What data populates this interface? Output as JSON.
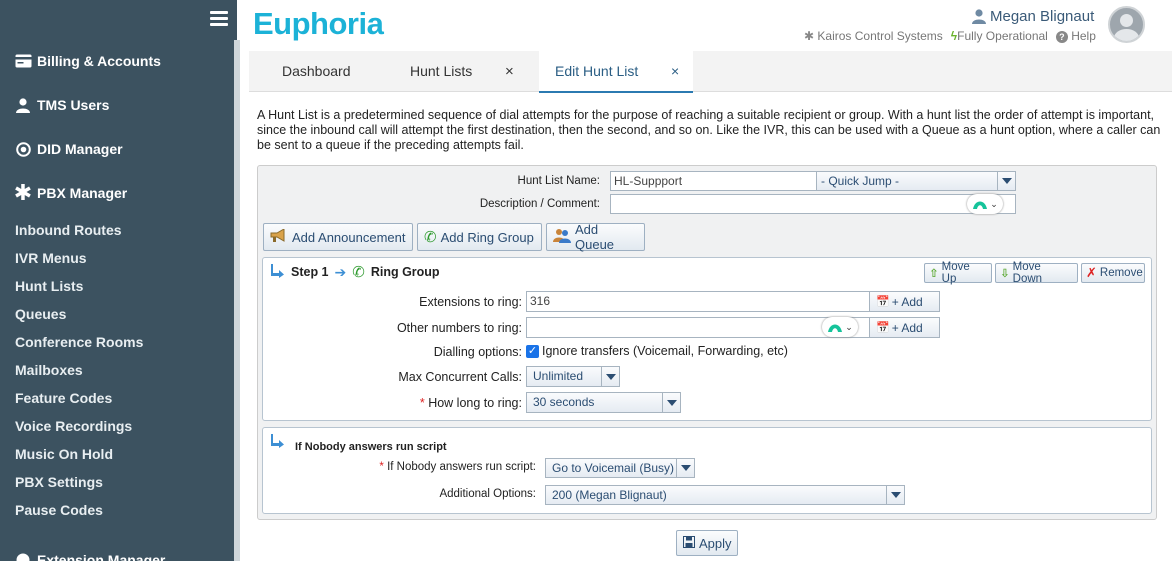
{
  "app": {
    "logo": "Euphoria"
  },
  "header": {
    "user_name": "Megan Blignaut",
    "company": "Kairos Control Systems",
    "system_status": "Fully Operational",
    "help": "Help"
  },
  "sidebar": {
    "main_items": [
      {
        "label": "Billing & Accounts",
        "icon": "billing-icon"
      },
      {
        "label": "TMS Users",
        "icon": "user-icon"
      },
      {
        "label": "DID Manager",
        "icon": "dot-circle-icon"
      },
      {
        "label": "PBX Manager",
        "icon": "asterisk-icon"
      }
    ],
    "sub_items": [
      "Inbound Routes",
      "IVR Menus",
      "Hunt Lists",
      "Queues",
      "Conference Rooms",
      "Mailboxes",
      "Feature Codes",
      "Voice Recordings",
      "Music On Hold",
      "PBX Settings",
      "Pause Codes"
    ],
    "next_section": "Extension Manager"
  },
  "tabs": [
    {
      "label": "Dashboard",
      "closable": false
    },
    {
      "label": "Hunt Lists",
      "closable": true
    },
    {
      "label": "Edit Hunt List",
      "closable": true,
      "active": true
    }
  ],
  "close_glyph": "×",
  "description": "A Hunt List is a predetermined sequence of dial attempts for the purpose of reaching a suitable recipient or group. With a hunt list the order of attempt is important, since the inbound call will attempt the first destination, then the second, and so on. Like the IVR, this can be used with a Queue as a hunt option, where a caller can be sent to a queue if the preceding attempts fail.",
  "form": {
    "name_label": "Hunt List Name:",
    "name_value": "HL-Suppport",
    "quick_jump": "- Quick Jump -",
    "comment_label": "Description / Comment:",
    "comment_value": ""
  },
  "add_buttons": {
    "announcement": "Add Announcement",
    "ring_group": "Add Ring Group",
    "queue": "Add Queue"
  },
  "step1": {
    "title": "Step 1",
    "type": "Ring Group",
    "move_up": "Move Up",
    "move_down": "Move Down",
    "remove": "Remove",
    "extensions_label": "Extensions to ring:",
    "extensions_value": "316",
    "other_label": "Other numbers to ring:",
    "other_value": "",
    "add_label": "+ Add",
    "dialling_label": "Dialling options:",
    "ignore_transfers": "Ignore transfers (Voicemail, Forwarding, etc)",
    "ignore_transfers_checked": true,
    "max_calls_label": "Max Concurrent Calls:",
    "max_calls_value": "Unlimited",
    "ring_label": "How long to ring:",
    "ring_value": "30 seconds"
  },
  "nobody": {
    "title": "If Nobody answers run script",
    "script_label": "If Nobody answers run script:",
    "script_value": "Go to Voicemail (Busy)",
    "additional_label": "Additional Options:",
    "additional_value": "200 (Megan Blignaut)"
  },
  "apply": "Apply",
  "required_mark": "*",
  "colors": {
    "sidebar": "#3c5260",
    "logo": "#1cb2d7",
    "accent": "#2b7ab1"
  }
}
